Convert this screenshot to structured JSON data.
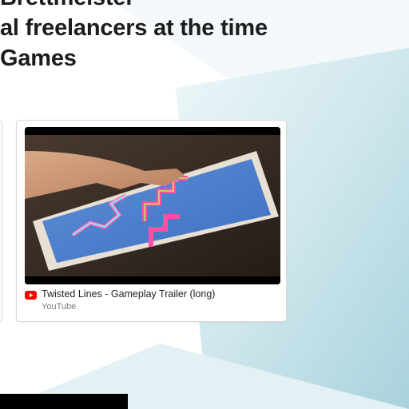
{
  "heading": {
    "line1": "Brettmeister",
    "line2": "al freelancers at the time",
    "line3": "Games"
  },
  "embed": {
    "title": "Twisted Lines - Gameplay Trailer (long)",
    "source": "YouTube",
    "icon": "youtube-icon"
  },
  "colors": {
    "stripe": "#c6e3ea",
    "heading": "#1c1c1c",
    "youtube_red": "#ff0000"
  }
}
